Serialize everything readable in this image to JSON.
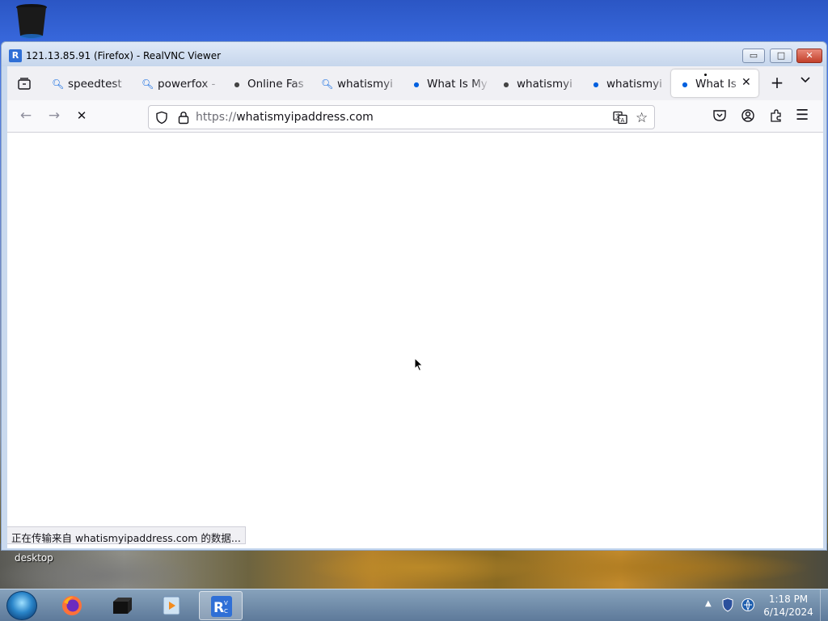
{
  "desktop": {
    "label": "desktop"
  },
  "vnc_window": {
    "title": "121.13.85.91 (Firefox) - RealVNC Viewer",
    "app_icon_text": "R"
  },
  "browser": {
    "tabs": [
      {
        "label": "speedtest",
        "icon": "search-icon"
      },
      {
        "label": "powerfox -",
        "icon": "search-icon"
      },
      {
        "label": "Online Fas",
        "icon": "dot-favicon"
      },
      {
        "label": "whatismyi",
        "icon": "search-icon"
      },
      {
        "label": "What Is My",
        "icon": "dot-favicon"
      },
      {
        "label": "whatismyi",
        "icon": "dot-favicon"
      },
      {
        "label": "whatismyi",
        "icon": "dot-favicon"
      },
      {
        "label": "What Is",
        "icon": "dot-favicon",
        "active": true
      }
    ],
    "url_scheme": "https://",
    "url_host": "whatismyipaddress.com",
    "status_text": "正在传输来自 whatismyipaddress.com 的数据..."
  },
  "taskbar": {
    "clock_time": "1:18 PM",
    "clock_date": "6/14/2024"
  },
  "colors": {
    "accent": "#0060df",
    "taskbar": "#6f8fb3"
  }
}
